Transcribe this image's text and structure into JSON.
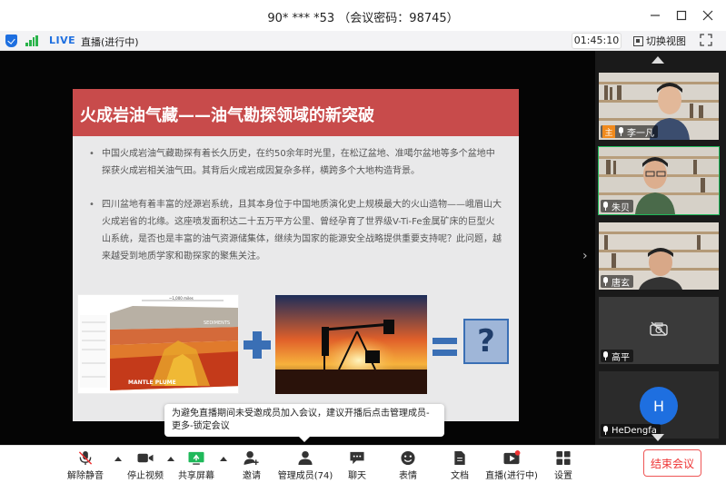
{
  "window": {
    "title": "90* *** *53 （会议密码：98745）",
    "minimize_icon": "minimize-icon",
    "maximize_icon": "maximize-icon",
    "close_icon": "close-icon"
  },
  "status_bar": {
    "live_label": "LIVE",
    "live_status": "直播(进行中)",
    "timer": "01:45:10",
    "switch_view_label": "切换视图"
  },
  "slide": {
    "title": "火成岩油气藏——油气勘探领域的新突破",
    "bullets": [
      "中国火成岩油气藏勘探有着长久历史，在约50余年时光里，在松辽盆地、准噶尔盆地等多个盆地中探获火成岩相关油气田。其背后火成岩成因复杂多样，横跨多个大地构造背景。",
      "四川盆地有着丰富的烃源岩系统，且其本身位于中国地质演化史上规模最大的火山造物——峨眉山大火成岩省的北缘。这座喷发面积达二十五万平方公里、曾经孕育了世界级V-Ti-Fe金属矿床的巨型火山系统，是否也是丰富的油气资源储集体，继续为国家的能源安全战略提供重要支持呢？此问题，越来越受到地质学家和勘探家的聚焦关注。"
    ],
    "figure_labels": {
      "scale": "~1,000 miles",
      "sediments": "SEDIMENTS",
      "mantle_plume": "MANTLE PLUME"
    },
    "question_mark": "?"
  },
  "tooltip": {
    "text": "为避免直播期间未受邀成员加入会议，建议开播后点击管理成员-更多-锁定会议"
  },
  "participants": [
    {
      "name": "李一凡",
      "host": true,
      "host_label": "主",
      "video": true,
      "active": false
    },
    {
      "name": "朱贝",
      "host": false,
      "video": true,
      "active": true
    },
    {
      "name": "唐玄",
      "host": false,
      "video": true,
      "active": false
    },
    {
      "name": "高平",
      "host": false,
      "video": false,
      "active": false
    },
    {
      "name": "HeDengfa",
      "host": false,
      "video": false,
      "avatar_letter": "H",
      "active": false
    }
  ],
  "toolbar": {
    "unmute": "解除静音",
    "stop_video": "停止视频",
    "share_screen": "共享屏幕",
    "invite": "邀请",
    "manage_members": "管理成员(74)",
    "chat": "聊天",
    "reactions": "表情",
    "documents": "文档",
    "live": "直播(进行中)",
    "settings": "设置",
    "end_meeting": "结束会议"
  },
  "colors": {
    "slide_header": "#c84b4b",
    "accent_blue": "#1e6fe0",
    "active_green": "#1fb95a",
    "end_red": "#e33333"
  }
}
